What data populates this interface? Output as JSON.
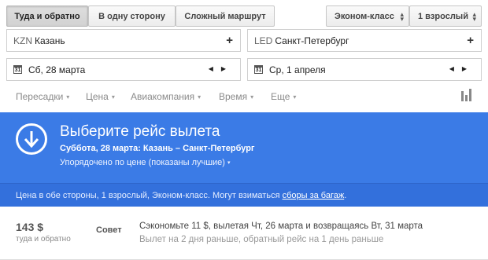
{
  "trip_tabs": [
    {
      "label": "Туда и обратно",
      "active": true
    },
    {
      "label": "В одну сторону",
      "active": false
    },
    {
      "label": "Сложный маршрут",
      "active": false
    }
  ],
  "cabin_select": {
    "value": "Эконом-класс"
  },
  "passengers_select": {
    "value": "1 взрослый"
  },
  "origin": {
    "code": "KZN",
    "city": "Казань"
  },
  "destination": {
    "code": "LED",
    "city": "Санкт-Петербург"
  },
  "depart_date": {
    "value": "Сб, 28 марта",
    "calendar_day": "31"
  },
  "return_date": {
    "value": "Ср, 1 апреля",
    "calendar_day": "31"
  },
  "filters": [
    "Пересадки",
    "Цена",
    "Авиакомпания",
    "Время",
    "Еще"
  ],
  "banner": {
    "title": "Выберите рейс вылета",
    "subtitle": "Суббота, 28 марта:  Казань – Санкт-Петербург",
    "sort": "Упорядочено по цене (показаны лучшие)"
  },
  "info": {
    "text": "Цена в обе стороны, 1 взрослый, Эконом-класс. Могут взиматься ",
    "link": "сборы за багаж",
    "end": "."
  },
  "result": {
    "price": "143 $",
    "price_note": "туда и обратно",
    "tip_label": "Совет",
    "tip_line1": "Сэкономьте 11 $, вылетая Чт, 26 марта и возвращаясь Вт, 31 марта",
    "tip_line2": "Вылет на 2 дня раньше, обратный рейс на 1 день раньше"
  },
  "colors": {
    "banner": "#3b7be6",
    "info_bar": "#3370dc"
  }
}
